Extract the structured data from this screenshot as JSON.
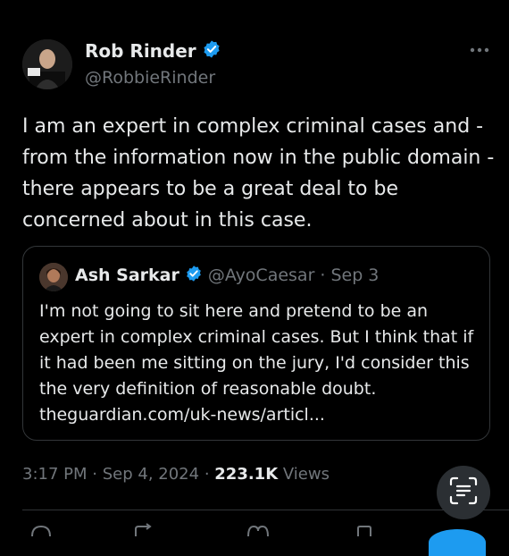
{
  "tweet": {
    "author": {
      "display_name": "Rob Rinder",
      "handle": "@RobbieRinder",
      "verified": true
    },
    "text": "I am an expert in complex criminal cases and - from the information now in the public domain - there appears to be a great deal to be concerned about in this case.",
    "time": "3:17 PM",
    "date": "Sep 4, 2024",
    "views_count": "223.1K",
    "views_label": "Views"
  },
  "quoted_tweet": {
    "author": {
      "display_name": "Ash Sarkar",
      "handle": "@AyoCaesar",
      "verified": true
    },
    "date": "Sep 3",
    "text": "I'm not going to sit here and pretend to be an expert in complex criminal cases. But I think that if it had been me sitting on the jury, I'd consider this the very definition of reasonable doubt. theguardian.com/uk-news/articl..."
  },
  "icons": {
    "verified": "verified-badge-icon",
    "more": "more-horizontal-icon",
    "scan": "text-scan-icon",
    "reply": "reply-icon",
    "retweet": "retweet-icon",
    "like": "like-icon",
    "bookmark": "bookmark-icon"
  },
  "colors": {
    "background": "#000000",
    "text": "#e7e9ea",
    "secondary": "#71767b",
    "accent": "#1d9bf0"
  }
}
